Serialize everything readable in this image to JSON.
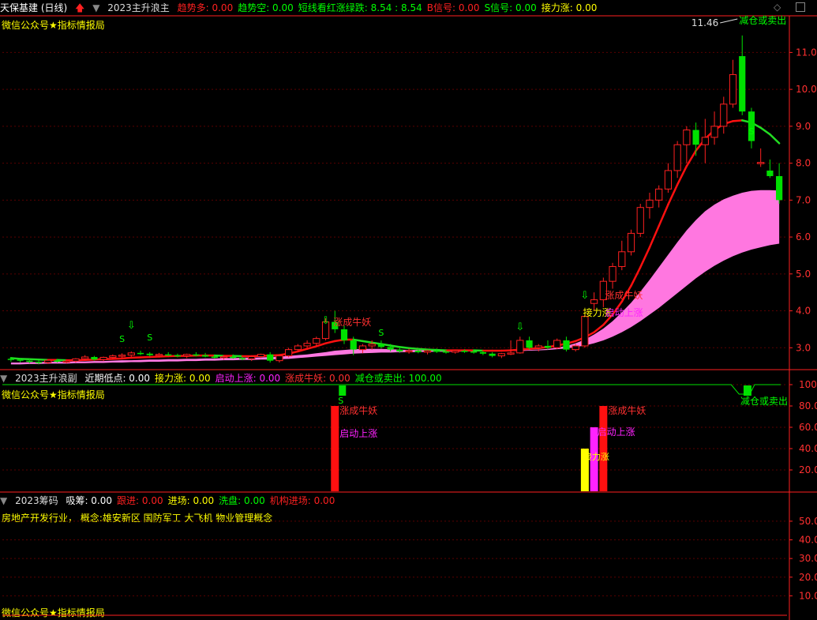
{
  "colors": {
    "up": "#ff2020",
    "down": "#00e000",
    "ma": "#ff1010",
    "band": "#ff77e0",
    "grid": "#5a0000",
    "axis": "#ff2020",
    "label_yellow": "#ffff00",
    "label_magenta": "#ff22ff",
    "label_red": "#ff3030",
    "label_green": "#00ff00"
  },
  "main_header": {
    "stock": "天保基建 (日线)",
    "indicator": "2023主升浪主",
    "items": [
      {
        "label": "趋势多:",
        "value": "0.00",
        "color": "#ff2020"
      },
      {
        "label": "趋势空:",
        "value": "0.00",
        "color": "#00ff00"
      },
      {
        "label": "短线看红涨绿跌:",
        "value": "8.54 : 8.54",
        "color": "#00ff00"
      },
      {
        "label": "B信号:",
        "value": "0.00",
        "color": "#ff2020"
      },
      {
        "label": "S信号:",
        "value": "0.00",
        "color": "#00ff00"
      },
      {
        "label": "接力涨:",
        "value": "0.00",
        "color": "#ffff00"
      }
    ],
    "watermark": "微信公众号★指标情报局"
  },
  "main_annotations": {
    "max_price": "11.46",
    "sell_label": "减仓或卖出",
    "yao1": "涨成牛妖",
    "yao2": "涨成牛妖",
    "relay": "接力涨",
    "start": "启动上涨",
    "s": "S"
  },
  "sub1_header": {
    "name": "2023主升浪副",
    "items": [
      {
        "label": "近期低点:",
        "value": "0.00",
        "color": "#ffffff"
      },
      {
        "label": "接力涨:",
        "value": "0.00",
        "color": "#ffff00"
      },
      {
        "label": "启动上涨:",
        "value": "0.00",
        "color": "#ff22ff"
      },
      {
        "label": "涨成牛妖:",
        "value": "0.00",
        "color": "#ff3030"
      },
      {
        "label": "减仓或卖出:",
        "value": "100.00",
        "color": "#00ff00"
      }
    ],
    "watermark": "微信公众号★指标情报局",
    "labels": {
      "yao": "涨成牛妖",
      "start": "启动上涨",
      "relay": "接力涨",
      "sell": "减仓或卖出",
      "s": "S"
    }
  },
  "sub2_header": {
    "name": "2023筹码",
    "items": [
      {
        "label": "吸筹:",
        "value": "0.00",
        "color": "#ffffff"
      },
      {
        "label": "跟进:",
        "value": "0.00",
        "color": "#ff2020"
      },
      {
        "label": "进场:",
        "value": "0.00",
        "color": "#ffff00"
      },
      {
        "label": "洗盘:",
        "value": "0.00",
        "color": "#00ff00"
      },
      {
        "label": "机构进场:",
        "value": "0.00",
        "color": "#ff2020"
      }
    ],
    "industry": "房地产开发行业， 概念:雄安新区 国防军工 大飞机 物业管理概念",
    "watermark": "微信公众号★指标情报局"
  },
  "chart_data": [
    {
      "type": "candlestick",
      "title": "2023主升浪主",
      "ylim": [
        2.45,
        11.95
      ],
      "y_ticks": [
        "11.0",
        "10.0",
        "9.0",
        "8.0",
        "7.0",
        "6.0",
        "5.0",
        "4.0",
        "3.0"
      ],
      "y_tick_values": [
        11,
        10,
        9,
        8,
        7,
        6,
        5,
        4,
        3
      ],
      "ohlc": [
        [
          2.7,
          2.75,
          2.62,
          2.68
        ],
        [
          2.68,
          2.72,
          2.6,
          2.65
        ],
        [
          2.65,
          2.7,
          2.58,
          2.62
        ],
        [
          2.62,
          2.66,
          2.55,
          2.6
        ],
        [
          2.6,
          2.68,
          2.56,
          2.66
        ],
        [
          2.66,
          2.7,
          2.6,
          2.62
        ],
        [
          2.62,
          2.66,
          2.58,
          2.64
        ],
        [
          2.64,
          2.72,
          2.6,
          2.7
        ],
        [
          2.7,
          2.8,
          2.66,
          2.75
        ],
        [
          2.75,
          2.78,
          2.65,
          2.68
        ],
        [
          2.68,
          2.76,
          2.64,
          2.74
        ],
        [
          2.74,
          2.82,
          2.7,
          2.78
        ],
        [
          2.78,
          2.85,
          2.72,
          2.8
        ],
        [
          2.8,
          2.9,
          2.76,
          2.86
        ],
        [
          2.86,
          2.92,
          2.8,
          2.84
        ],
        [
          2.84,
          2.88,
          2.76,
          2.8
        ],
        [
          2.8,
          2.86,
          2.75,
          2.82
        ],
        [
          2.82,
          2.88,
          2.78,
          2.8
        ],
        [
          2.8,
          2.84,
          2.74,
          2.78
        ],
        [
          2.78,
          2.84,
          2.72,
          2.82
        ],
        [
          2.82,
          2.88,
          2.76,
          2.8
        ],
        [
          2.8,
          2.86,
          2.74,
          2.76
        ],
        [
          2.76,
          2.8,
          2.7,
          2.74
        ],
        [
          2.74,
          2.8,
          2.68,
          2.76
        ],
        [
          2.76,
          2.82,
          2.7,
          2.72
        ],
        [
          2.72,
          2.76,
          2.66,
          2.7
        ],
        [
          2.7,
          2.78,
          2.64,
          2.76
        ],
        [
          2.76,
          2.84,
          2.72,
          2.82
        ],
        [
          2.82,
          2.88,
          2.6,
          2.65
        ],
        [
          2.65,
          2.8,
          2.6,
          2.78
        ],
        [
          2.78,
          3.0,
          2.74,
          2.95
        ],
        [
          2.95,
          3.1,
          2.9,
          3.05
        ],
        [
          3.05,
          3.2,
          3.0,
          3.12
        ],
        [
          3.12,
          3.3,
          3.05,
          3.25
        ],
        [
          3.25,
          3.8,
          3.2,
          3.7
        ],
        [
          3.7,
          4.0,
          3.4,
          3.5
        ],
        [
          3.5,
          3.6,
          3.1,
          3.2
        ],
        [
          3.2,
          3.3,
          2.8,
          2.95
        ],
        [
          2.95,
          3.1,
          2.85,
          3.05
        ],
        [
          3.05,
          3.2,
          2.95,
          3.1
        ],
        [
          3.1,
          3.2,
          2.98,
          3.02
        ],
        [
          3.02,
          3.1,
          2.9,
          2.95
        ],
        [
          2.95,
          3.02,
          2.86,
          2.9
        ],
        [
          2.9,
          2.98,
          2.84,
          2.92
        ],
        [
          2.92,
          2.98,
          2.85,
          2.88
        ],
        [
          2.88,
          2.95,
          2.82,
          2.92
        ],
        [
          2.92,
          2.98,
          2.86,
          2.9
        ],
        [
          2.9,
          2.96,
          2.84,
          2.88
        ],
        [
          2.88,
          2.94,
          2.84,
          2.92
        ],
        [
          2.92,
          2.96,
          2.86,
          2.9
        ],
        [
          2.9,
          2.95,
          2.84,
          2.88
        ],
        [
          2.88,
          2.92,
          2.8,
          2.84
        ],
        [
          2.84,
          2.88,
          2.74,
          2.78
        ],
        [
          2.78,
          2.86,
          2.72,
          2.84
        ],
        [
          2.84,
          3.2,
          2.8,
          2.86
        ],
        [
          2.86,
          3.3,
          2.84,
          3.2
        ],
        [
          3.2,
          3.3,
          2.96,
          3.0
        ],
        [
          3.0,
          3.1,
          2.9,
          3.05
        ],
        [
          3.05,
          3.2,
          2.95,
          3.0
        ],
        [
          3.0,
          3.25,
          2.96,
          3.2
        ],
        [
          3.2,
          3.3,
          2.9,
          2.95
        ],
        [
          2.95,
          3.1,
          2.9,
          3.05
        ],
        [
          3.05,
          3.9,
          3.0,
          3.85
        ],
        [
          4.2,
          4.5,
          4.0,
          4.3
        ],
        [
          4.3,
          4.9,
          4.1,
          4.8
        ],
        [
          4.8,
          5.3,
          4.6,
          5.2
        ],
        [
          5.2,
          5.9,
          5.1,
          5.6
        ],
        [
          5.6,
          6.2,
          5.5,
          6.1
        ],
        [
          6.1,
          6.9,
          6.0,
          6.8
        ],
        [
          6.8,
          7.2,
          6.5,
          7.0
        ],
        [
          7.0,
          7.4,
          6.8,
          7.3
        ],
        [
          7.3,
          8.0,
          7.2,
          7.8
        ],
        [
          7.8,
          8.6,
          7.6,
          8.5
        ],
        [
          8.5,
          9.0,
          8.0,
          8.9
        ],
        [
          8.9,
          9.1,
          8.2,
          8.5
        ],
        [
          8.5,
          9.2,
          8.0,
          8.7
        ],
        [
          8.7,
          9.4,
          8.5,
          9.0
        ],
        [
          9.0,
          9.8,
          8.8,
          9.6
        ],
        [
          9.6,
          10.8,
          9.5,
          10.4
        ],
        [
          10.9,
          11.46,
          9.3,
          9.4
        ],
        [
          9.4,
          9.5,
          8.4,
          8.6
        ],
        [
          8.02,
          8.4,
          7.9,
          8.02
        ],
        [
          7.8,
          8.1,
          7.6,
          7.65
        ],
        [
          7.65,
          8.0,
          6.9,
          7.0
        ]
      ],
      "ma_line": [
        2.72,
        2.7,
        2.69,
        2.68,
        2.67,
        2.67,
        2.66,
        2.66,
        2.67,
        2.68,
        2.69,
        2.7,
        2.71,
        2.73,
        2.74,
        2.75,
        2.76,
        2.77,
        2.78,
        2.78,
        2.79,
        2.79,
        2.79,
        2.78,
        2.78,
        2.77,
        2.77,
        2.78,
        2.79,
        2.8,
        2.84,
        2.9,
        2.97,
        3.04,
        3.12,
        3.18,
        3.22,
        3.22,
        3.18,
        3.14,
        3.1,
        3.06,
        3.02,
        2.99,
        2.97,
        2.95,
        2.94,
        2.93,
        2.93,
        2.93,
        2.93,
        2.92,
        2.92,
        2.92,
        2.93,
        2.95,
        2.97,
        2.99,
        3.02,
        3.06,
        3.11,
        3.18,
        3.28,
        3.42,
        3.62,
        3.9,
        4.25,
        4.68,
        5.18,
        5.72,
        6.3,
        6.88,
        7.42,
        7.92,
        8.34,
        8.66,
        8.9,
        9.06,
        9.14,
        9.16,
        9.1,
        8.96,
        8.78,
        8.54
      ],
      "band_upper": [
        2.6,
        2.6,
        2.61,
        2.61,
        2.62,
        2.62,
        2.62,
        2.63,
        2.63,
        2.64,
        2.64,
        2.65,
        2.66,
        2.66,
        2.67,
        2.68,
        2.68,
        2.69,
        2.69,
        2.7,
        2.7,
        2.71,
        2.71,
        2.72,
        2.72,
        2.73,
        2.73,
        2.74,
        2.75,
        2.76,
        2.78,
        2.8,
        2.82,
        2.85,
        2.88,
        2.92,
        2.94,
        2.96,
        2.97,
        2.97,
        2.97,
        2.96,
        2.95,
        2.94,
        2.94,
        2.93,
        2.93,
        2.92,
        2.92,
        2.92,
        2.92,
        2.92,
        2.92,
        2.92,
        2.92,
        2.93,
        2.94,
        2.95,
        2.97,
        3.0,
        3.05,
        3.12,
        3.22,
        3.36,
        3.52,
        3.72,
        3.96,
        4.22,
        4.52,
        4.84,
        5.18,
        5.52,
        5.86,
        6.18,
        6.46,
        6.7,
        6.88,
        7.02,
        7.12,
        7.2,
        7.25,
        7.27,
        7.27,
        7.26
      ],
      "band_lower": [
        2.55,
        2.55,
        2.56,
        2.56,
        2.57,
        2.57,
        2.57,
        2.58,
        2.58,
        2.59,
        2.59,
        2.6,
        2.6,
        2.61,
        2.61,
        2.62,
        2.62,
        2.63,
        2.63,
        2.64,
        2.64,
        2.65,
        2.65,
        2.66,
        2.66,
        2.67,
        2.67,
        2.68,
        2.68,
        2.69,
        2.7,
        2.72,
        2.74,
        2.76,
        2.78,
        2.8,
        2.82,
        2.84,
        2.85,
        2.86,
        2.87,
        2.87,
        2.88,
        2.88,
        2.88,
        2.89,
        2.89,
        2.89,
        2.89,
        2.9,
        2.9,
        2.9,
        2.9,
        2.9,
        2.91,
        2.91,
        2.92,
        2.93,
        2.94,
        2.96,
        2.98,
        3.02,
        3.06,
        3.12,
        3.2,
        3.3,
        3.42,
        3.56,
        3.72,
        3.9,
        4.08,
        4.28,
        4.48,
        4.68,
        4.88,
        5.06,
        5.22,
        5.36,
        5.48,
        5.58,
        5.66,
        5.72,
        5.78,
        5.82
      ]
    },
    {
      "type": "bar",
      "title": "2023主升浪副",
      "ylim": [
        0,
        100
      ],
      "y_ticks": [
        "100",
        "80.00",
        "60.00",
        "40.00",
        "20.00"
      ],
      "y_tick_values": [
        100,
        80,
        60,
        40,
        20
      ],
      "bars": [
        {
          "index": 35,
          "value": 80,
          "name": "涨成牛妖",
          "color": "#ff1010"
        },
        {
          "index": 62,
          "value": 40,
          "name": "接力涨",
          "color": "#ffff00"
        },
        {
          "index": 63,
          "value": 60,
          "name": "启动上涨",
          "color": "#ff22ff"
        },
        {
          "index": 64,
          "value": 80,
          "name": "涨成牛妖",
          "color": "#ff1010"
        }
      ],
      "sell_line_value": 100
    },
    {
      "type": "bar",
      "title": "2023筹码",
      "ylim": [
        0,
        58
      ],
      "y_ticks": [
        "50.00",
        "40.00",
        "30.00",
        "20.00",
        "10.00"
      ],
      "y_tick_values": [
        50,
        40,
        30,
        20,
        10
      ],
      "bars": []
    }
  ]
}
